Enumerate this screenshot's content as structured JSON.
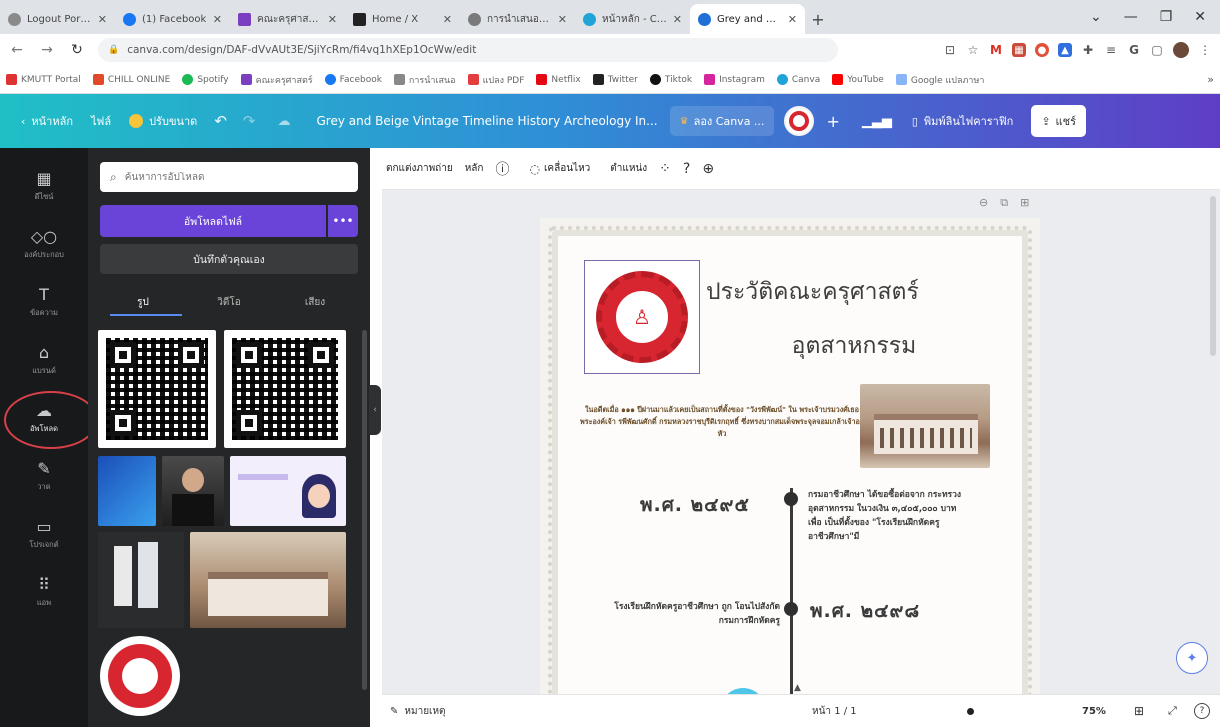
{
  "browser": {
    "tabs": [
      {
        "label": "Logout Portal",
        "color": "#8a8a8a"
      },
      {
        "label": "(1) Facebook",
        "color": "#1877f2"
      },
      {
        "label": "คณะครุศาสตร์อุตสาห",
        "color": "#7b3fbf"
      },
      {
        "label": "Home / X",
        "color": "#222222"
      },
      {
        "label": "การนำเสนอข้อมูลด้ว",
        "color": "#7a7a7a"
      },
      {
        "label": "หน้าหลัก - Canva",
        "color": "#20a4d8"
      },
      {
        "label": "Grey and Beige Vi",
        "color": "#1f6fd6"
      }
    ],
    "url": "canva.com/design/DAF-dVvAUt3E/SjiYcRm/fi4vq1hXEp1OcWw/edit",
    "bookmarks": [
      {
        "label": "KMUTT Portal",
        "color": "#d33"
      },
      {
        "label": "CHILL ONLINE",
        "color": "#e04a2a"
      },
      {
        "label": "Spotify",
        "color": "#1db954"
      },
      {
        "label": "คณะครุศาสตร์",
        "color": "#7b3fbf"
      },
      {
        "label": "Facebook",
        "color": "#1877f2"
      },
      {
        "label": "การนำเสนอ",
        "color": "#888888"
      },
      {
        "label": "แปลง PDF",
        "color": "#e33d3d"
      },
      {
        "label": "Netflix",
        "color": "#e50914"
      },
      {
        "label": "Twitter",
        "color": "#222222"
      },
      {
        "label": "Tiktok",
        "color": "#111111"
      },
      {
        "label": "Instagram",
        "color": "#d6249f"
      },
      {
        "label": "Canva",
        "color": "#20a4d8"
      },
      {
        "label": "YouTube",
        "color": "#ff0000"
      },
      {
        "label": "Google แปลภาษา",
        "color": "#8ab4f8"
      }
    ]
  },
  "header": {
    "home": "หน้าหลัก",
    "file": "ไฟล์",
    "resize": "ปรับขนาด",
    "doc_title": "Grey and Beige Vintage Timeline History Archeology In...",
    "try_pro": "ลอง Canva ...",
    "print": "พิมพ์ลินไฟคาราฟิก",
    "share": "แชร์"
  },
  "rail": [
    {
      "label": "ดีไซน์",
      "icon": "layout-icon"
    },
    {
      "label": "องค์ประกอบ",
      "icon": "shapes-icon"
    },
    {
      "label": "ข้อความ",
      "icon": "text-icon"
    },
    {
      "label": "แบรนด์",
      "icon": "brand-icon"
    },
    {
      "label": "อัพโหลด",
      "icon": "cloud-upload-icon"
    },
    {
      "label": "วาด",
      "icon": "draw-icon"
    },
    {
      "label": "โปรเจกต์",
      "icon": "folder-icon"
    },
    {
      "label": "แอพ",
      "icon": "apps-icon"
    }
  ],
  "panel": {
    "search_placeholder": "ค้นหาการอัปโหลด",
    "upload_label": "อัพโหลดไฟล์",
    "record_label": "บันทึกตัวคุณเอง",
    "tabs": [
      "รูป",
      "วิดีโอ",
      "เสียง"
    ]
  },
  "toolbar": {
    "edit_photo": "ตกแต่งภาพถ่าย",
    "crop": "หลัก",
    "animate": "เคลื่อนไหว",
    "position": "ตำแหน่ง"
  },
  "poster": {
    "title_line1": "ประวัติคณะครุศาสตร์",
    "title_line2": "อุตสาหกรรม",
    "intro": "ในอดีตเมื่อ ๑๑๑ ปีผ่านมาแล้วเคยเป็นสถานที่ตั้งของ \"วังรพีพัฒน์\" ใน พระเจ้าบรมวงศ์เธอ พระองค์เจ้า รพีพัฒนศักดิ์ กรมหลวงราชบุรีดิเรกฤทธิ์ ซึ่งทรงบากสมเด็จพระจุลจอมเกล้าเจ้าอยู่หัว",
    "year1": "พ.ศ. ๒๔๙๕",
    "event1": "กรมอาชีวศึกษา ได้ขอซื้อต่อจาก กระทรวงอุตสาหกรรม ในวงเงิน ๓,๔๐๕,๐๐๐ บาท เพื่อ เป็นที่ตั้งของ \"โรงเรียนฝึกหัดครูอาชีวศึกษา\"มี",
    "event2": "โรงเรียนฝึกหัดครูอาชีวศึกษา ถูก โอนไปสังกัดกรมการฝึกหัดครู",
    "year2": "พ.ศ. ๒๔๙๘"
  },
  "bottom": {
    "notes": "หมายเหตุ",
    "page": "หน้า 1 / 1",
    "zoom": "75%"
  }
}
